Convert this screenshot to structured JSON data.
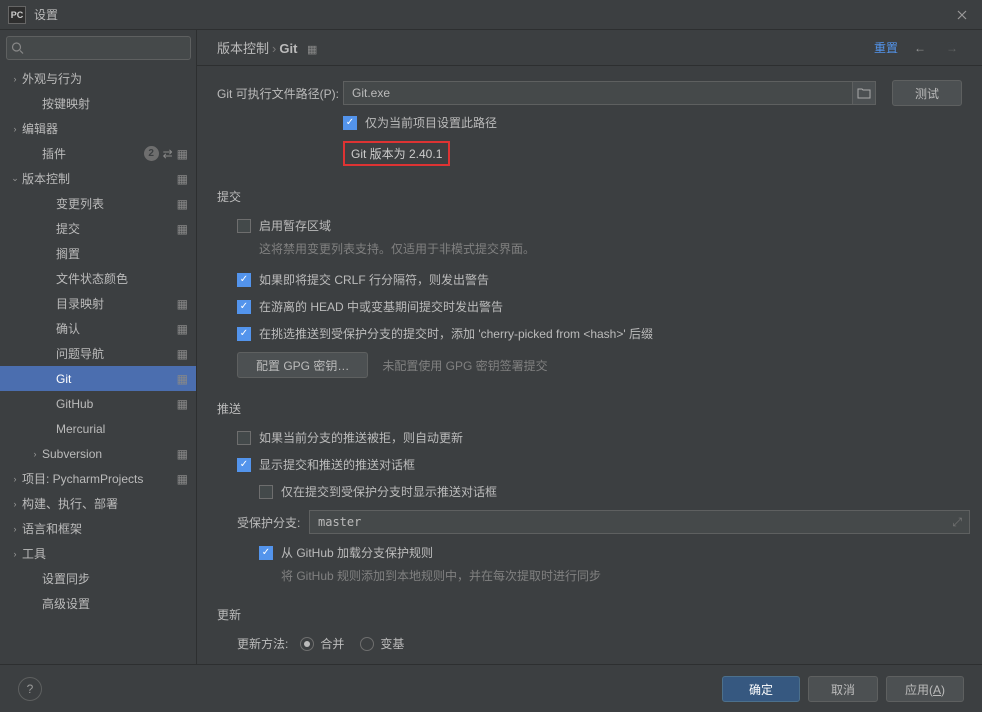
{
  "window": {
    "title": "设置"
  },
  "search": {
    "placeholder": ""
  },
  "sidebar": {
    "items": [
      {
        "label": "外观与行为",
        "arrow": "›",
        "indent": 0
      },
      {
        "label": "按键映射",
        "arrow": "",
        "indent": 1
      },
      {
        "label": "编辑器",
        "arrow": "›",
        "indent": 0
      },
      {
        "label": "插件",
        "arrow": "",
        "indent": 1,
        "badge": "2",
        "special": true
      },
      {
        "label": "版本控制",
        "arrow": "∨",
        "indent": 0,
        "gear": true
      },
      {
        "label": "变更列表",
        "arrow": "",
        "indent": 2,
        "gear": true
      },
      {
        "label": "提交",
        "arrow": "",
        "indent": 2,
        "gear": true
      },
      {
        "label": "搁置",
        "arrow": "",
        "indent": 2
      },
      {
        "label": "文件状态颜色",
        "arrow": "",
        "indent": 2
      },
      {
        "label": "目录映射",
        "arrow": "",
        "indent": 2,
        "gear": true
      },
      {
        "label": "确认",
        "arrow": "",
        "indent": 2,
        "gear": true
      },
      {
        "label": "问题导航",
        "arrow": "",
        "indent": 2,
        "gear": true
      },
      {
        "label": "Git",
        "arrow": "",
        "indent": 2,
        "gear": true,
        "selected": true
      },
      {
        "label": "GitHub",
        "arrow": "",
        "indent": 2,
        "gear": true
      },
      {
        "label": "Mercurial",
        "arrow": "",
        "indent": 2
      },
      {
        "label": "Subversion",
        "arrow": "›",
        "indent": 1,
        "gear": true
      },
      {
        "label": "项目: PycharmProjects",
        "arrow": "›",
        "indent": 0,
        "gear": true
      },
      {
        "label": "构建、执行、部署",
        "arrow": "›",
        "indent": 0
      },
      {
        "label": "语言和框架",
        "arrow": "›",
        "indent": 0
      },
      {
        "label": "工具",
        "arrow": "›",
        "indent": 0
      },
      {
        "label": "设置同步",
        "arrow": "",
        "indent": 1
      },
      {
        "label": "高级设置",
        "arrow": "",
        "indent": 1
      }
    ]
  },
  "breadcrumb": {
    "p1": "版本控制",
    "p2": "Git"
  },
  "header": {
    "reset": "重置"
  },
  "git": {
    "path_label": "Git 可执行文件路径(P):",
    "path_value": "Git.exe",
    "test_btn": "测试",
    "only_project": "仅为当前项目设置此路径",
    "version_text": "Git 版本为 2.40.1"
  },
  "commit": {
    "title": "提交",
    "enable_staging": "启用暂存区域",
    "staging_desc": "这将禁用变更列表支持。仅适用于非模式提交界面。",
    "crlf": "如果即将提交 CRLF 行分隔符，则发出警告",
    "detached": "在游离的 HEAD 中或变基期间提交时发出警告",
    "cherry": "在挑选推送到受保护分支的提交时，添加 'cherry-picked from <hash>' 后缀",
    "gpg_btn": "配置 GPG 密钥…",
    "gpg_desc": "未配置使用 GPG 密钥签署提交"
  },
  "push": {
    "title": "推送",
    "auto_update": "如果当前分支的推送被拒，则自动更新",
    "show_dialog": "显示提交和推送的推送对话框",
    "only_protected": "仅在提交到受保护分支时显示推送对话框",
    "protected_label": "受保护分支:",
    "protected_value": "master",
    "github_rules": "从 GitHub 加载分支保护规则",
    "github_desc": "将 GitHub 规则添加到本地规则中，并在每次提取时进行同步"
  },
  "update": {
    "title": "更新",
    "method_label": "更新方法:",
    "merge": "合并",
    "rebase": "变基"
  },
  "footer": {
    "ok": "确定",
    "cancel": "取消",
    "apply": "应用(A)",
    "apply_u": "A"
  }
}
